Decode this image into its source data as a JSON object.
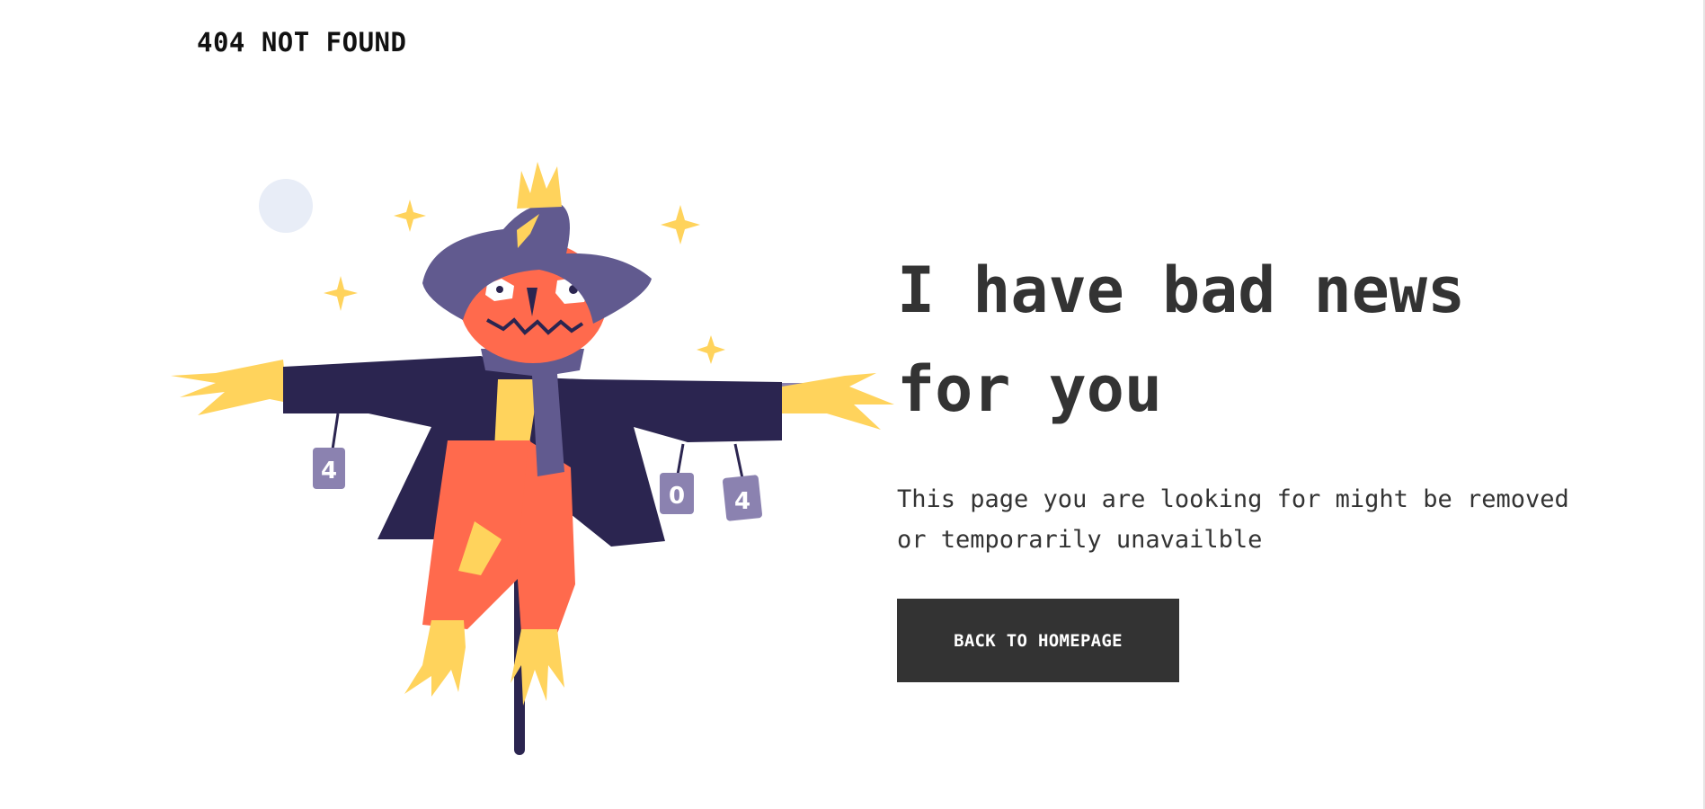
{
  "header": {
    "title": "404 NOT FOUND"
  },
  "main": {
    "headline": "I have bad news for you",
    "message": "This page you are looking for might be removed or temporarily unavailble",
    "button_label": "BACK TO HOMEPAGE"
  },
  "illustration": {
    "icon": "scarecrow-illustration",
    "can_labels": [
      "4",
      "0",
      "4"
    ]
  },
  "colors": {
    "text": "#333333",
    "button_bg": "#333333",
    "button_text": "#ffffff",
    "hat": "#615a8f",
    "coat": "#2b2550",
    "pumpkin": "#ff6a4d",
    "straw": "#ffd35c",
    "moon": "#e8edf7"
  }
}
